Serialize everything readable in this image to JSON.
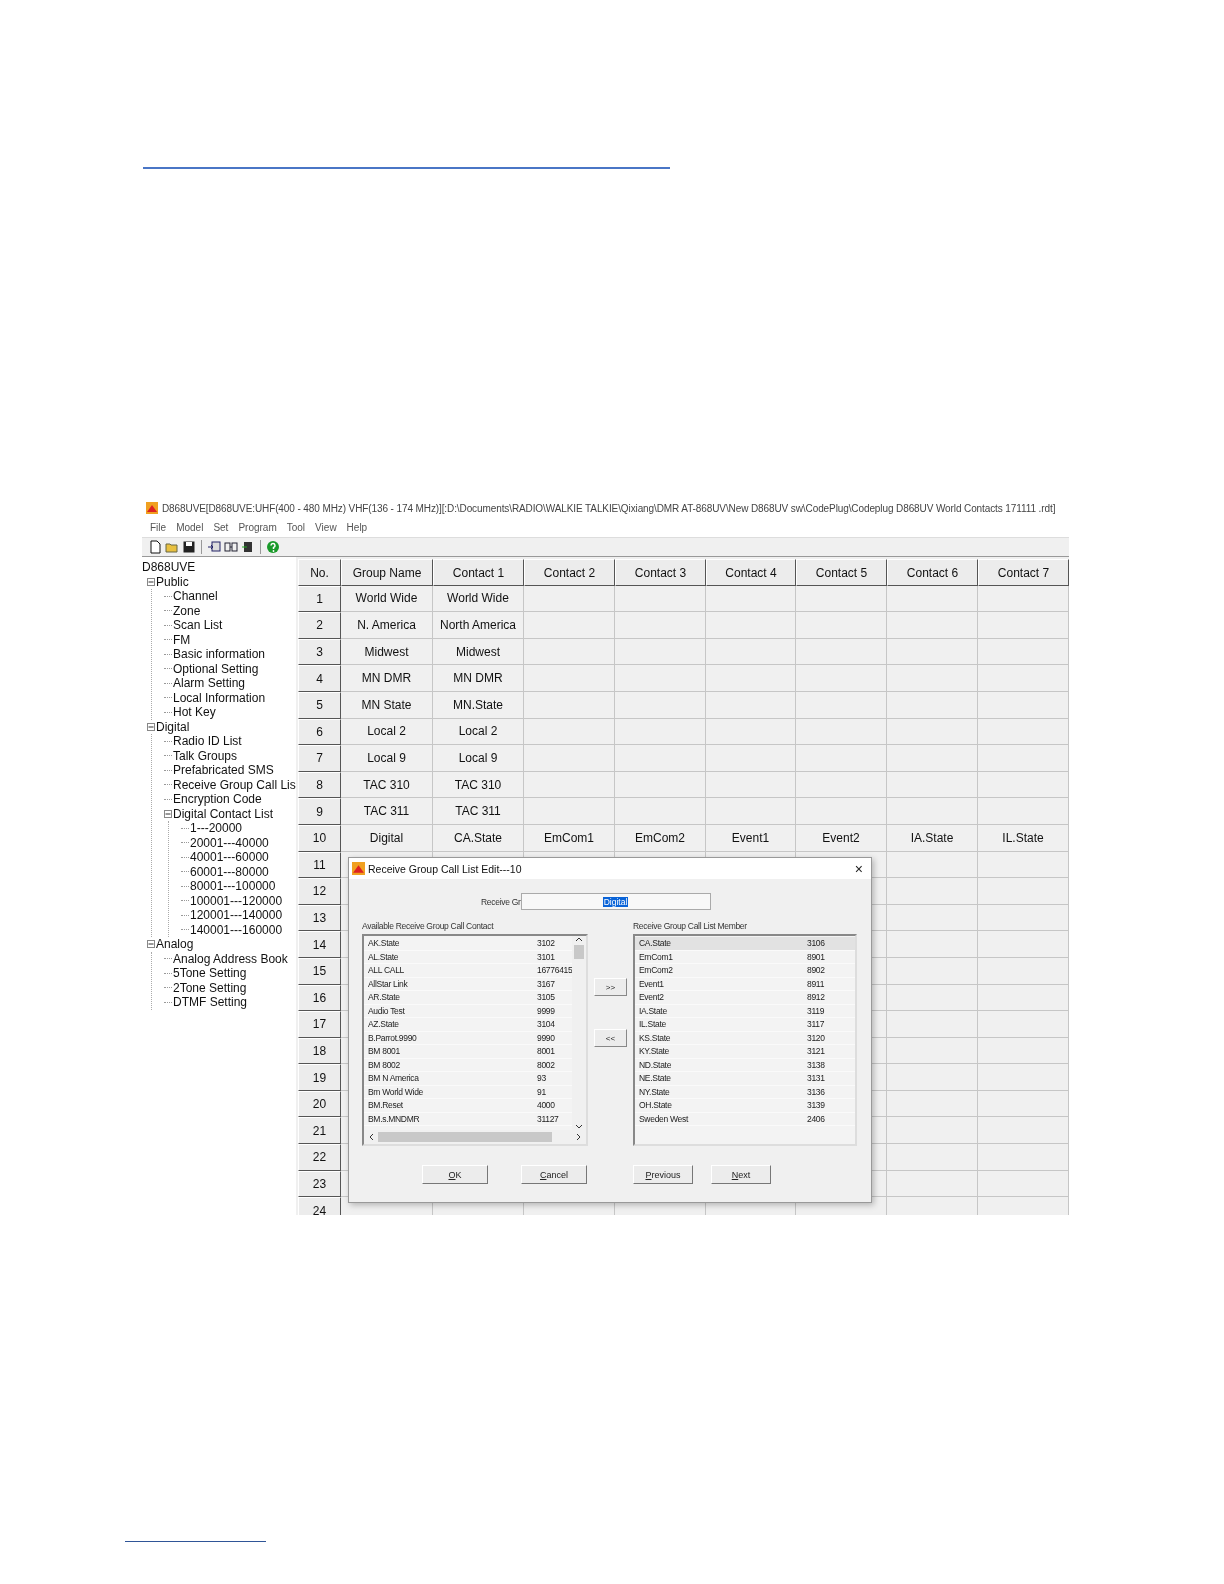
{
  "window": {
    "title": "D868UVE[D868UVE:UHF(400 - 480 MHz) VHF(136 - 174 MHz)][:D:\\Documents\\RADIO\\WALKIE TALKIE\\Qixiang\\DMR AT-868UV\\New D868UV sw\\CodePlug\\Codeplug D868UV World Contacts 171111 .rdt]"
  },
  "menu": [
    "File",
    "Model",
    "Set",
    "Program",
    "Tool",
    "View",
    "Help"
  ],
  "toolbar": [
    {
      "kind": "new"
    },
    {
      "kind": "open"
    },
    {
      "kind": "save"
    },
    {
      "kind": "separator"
    },
    {
      "kind": "read"
    },
    {
      "kind": "link"
    },
    {
      "kind": "write"
    },
    {
      "kind": "separator"
    },
    {
      "kind": "help"
    }
  ],
  "tree": {
    "label": "D868UVE",
    "children": [
      {
        "label": "Public",
        "expanded": true,
        "children": [
          {
            "label": "Channel"
          },
          {
            "label": "Zone"
          },
          {
            "label": "Scan List"
          },
          {
            "label": "FM"
          },
          {
            "label": "Basic information"
          },
          {
            "label": "Optional Setting"
          },
          {
            "label": "Alarm Setting"
          },
          {
            "label": "Local Information"
          },
          {
            "label": "Hot Key"
          }
        ]
      },
      {
        "label": "Digital",
        "expanded": true,
        "children": [
          {
            "label": "Radio ID List"
          },
          {
            "label": "Talk Groups"
          },
          {
            "label": "Prefabricated SMS"
          },
          {
            "label": "Receive Group Call Lis"
          },
          {
            "label": "Encryption Code"
          },
          {
            "label": "Digital Contact List",
            "expanded": true,
            "children": [
              {
                "label": "1---20000"
              },
              {
                "label": "20001---40000"
              },
              {
                "label": "40001---60000"
              },
              {
                "label": "60001---80000"
              },
              {
                "label": "80001---100000"
              },
              {
                "label": "100001---120000"
              },
              {
                "label": "120001---140000"
              },
              {
                "label": "140001---160000"
              }
            ]
          }
        ]
      },
      {
        "label": "Analog",
        "expanded": true,
        "children": [
          {
            "label": "Analog Address Book"
          },
          {
            "label": "5Tone Setting"
          },
          {
            "label": "2Tone Setting"
          },
          {
            "label": "DTMF Setting"
          }
        ]
      }
    ]
  },
  "table": {
    "columns": [
      "No.",
      "Group Name",
      "Contact 1",
      "Contact 2",
      "Contact 3",
      "Contact 4",
      "Contact 5",
      "Contact 6",
      "Contact 7"
    ],
    "rows": [
      {
        "no": "1",
        "cells": [
          "World Wide",
          "World Wide"
        ]
      },
      {
        "no": "2",
        "cells": [
          "N. America",
          "North America"
        ]
      },
      {
        "no": "3",
        "cells": [
          "Midwest",
          "Midwest"
        ]
      },
      {
        "no": "4",
        "cells": [
          "MN DMR",
          "MN DMR"
        ]
      },
      {
        "no": "5",
        "cells": [
          "MN State",
          "MN.State"
        ]
      },
      {
        "no": "6",
        "cells": [
          "Local 2",
          "Local 2"
        ]
      },
      {
        "no": "7",
        "cells": [
          "Local 9",
          "Local 9"
        ]
      },
      {
        "no": "8",
        "cells": [
          "TAC 310",
          "TAC 310"
        ]
      },
      {
        "no": "9",
        "cells": [
          "TAC 311",
          "TAC 311"
        ]
      },
      {
        "no": "10",
        "cells": [
          "Digital",
          "CA.State",
          "EmCom1",
          "EmCom2",
          "Event1",
          "Event2",
          "IA.State",
          "IL.State"
        ]
      },
      {
        "no": "11"
      },
      {
        "no": "12"
      },
      {
        "no": "13"
      },
      {
        "no": "14"
      },
      {
        "no": "15"
      },
      {
        "no": "16"
      },
      {
        "no": "17"
      },
      {
        "no": "18"
      },
      {
        "no": "19"
      },
      {
        "no": "20"
      },
      {
        "no": "21"
      },
      {
        "no": "22"
      },
      {
        "no": "23"
      },
      {
        "no": "24"
      }
    ]
  },
  "dialog": {
    "title": "Receive Group Call List Edit---10",
    "close": "×",
    "name_field": {
      "label": "Receive Gr",
      "value": "Digital",
      "highlighted": true
    },
    "available": {
      "label": "Available Receive Group Call Contact",
      "items": [
        {
          "name": "AK.State",
          "id": "3102",
          "selected": false
        },
        {
          "name": "AL.State",
          "id": "3101",
          "selected": false
        },
        {
          "name": "ALL CALL",
          "id": "16776415",
          "selected": false
        },
        {
          "name": "AllStar Link",
          "id": "3167",
          "selected": false
        },
        {
          "name": "AR.State",
          "id": "3105",
          "selected": false
        },
        {
          "name": "Audio Test",
          "id": "9999",
          "selected": false
        },
        {
          "name": "AZ.State",
          "id": "3104",
          "selected": false
        },
        {
          "name": "B.Parrot.9990",
          "id": "9990",
          "selected": false
        },
        {
          "name": "BM 8001",
          "id": "8001",
          "selected": false
        },
        {
          "name": "BM 8002",
          "id": "8002",
          "selected": false
        },
        {
          "name": "BM N America",
          "id": "93",
          "selected": false
        },
        {
          "name": "Bm World Wide",
          "id": "91",
          "selected": false
        },
        {
          "name": "BM.Reset",
          "id": "4000",
          "selected": false
        },
        {
          "name": "BM.s.MNDMR",
          "id": "31127",
          "selected": false
        }
      ]
    },
    "add": ">>",
    "remove": "<<",
    "members": {
      "label": "Receive Group Call List Member",
      "items": [
        {
          "name": "CA.State",
          "id": "3106",
          "selected": true
        },
        {
          "name": "EmCom1",
          "id": "8901",
          "selected": false
        },
        {
          "name": "EmCom2",
          "id": "8902",
          "selected": false
        },
        {
          "name": "Event1",
          "id": "8911",
          "selected": false
        },
        {
          "name": "Event2",
          "id": "8912",
          "selected": false
        },
        {
          "name": "IA.State",
          "id": "3119",
          "selected": false
        },
        {
          "name": "IL.State",
          "id": "3117",
          "selected": false
        },
        {
          "name": "KS.State",
          "id": "3120",
          "selected": false
        },
        {
          "name": "KY.State",
          "id": "3121",
          "selected": false
        },
        {
          "name": "ND.State",
          "id": "3138",
          "selected": false
        },
        {
          "name": "NE.State",
          "id": "3131",
          "selected": false
        },
        {
          "name": "NY.State",
          "id": "3136",
          "selected": false
        },
        {
          "name": "OH.State",
          "id": "3139",
          "selected": false
        },
        {
          "name": "Sweden West",
          "id": "2406",
          "selected": false
        }
      ]
    },
    "buttons": [
      "OK",
      "Cancel",
      "Previous",
      "Next"
    ]
  }
}
